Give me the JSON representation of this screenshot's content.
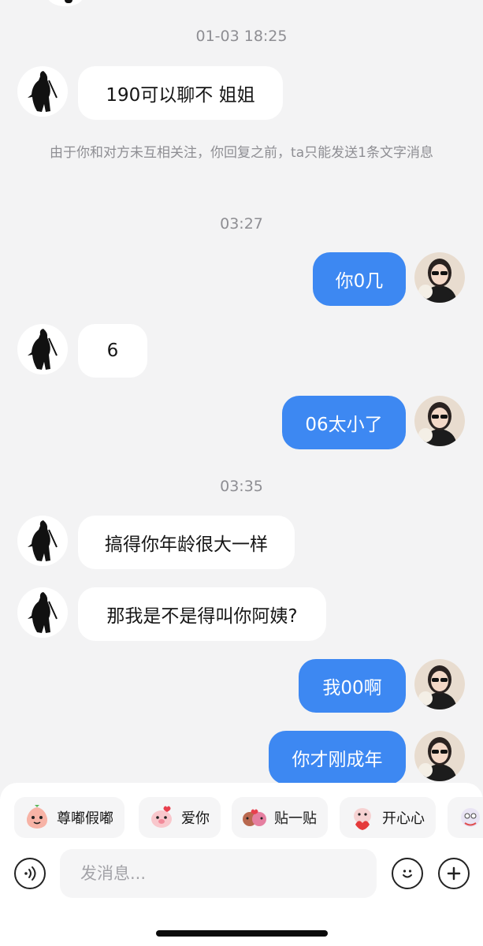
{
  "chat": {
    "timestamps": [
      "01-03 18:25",
      "03:27",
      "03:35"
    ],
    "notice": "由于你和对方未互相关注，你回复之前，ta只能发送1条文字消息",
    "messages": [
      {
        "side": "in",
        "text": "190可以聊不  姐姐"
      },
      {
        "side": "out",
        "text": "你0几"
      },
      {
        "side": "in",
        "text": "6"
      },
      {
        "side": "out",
        "text": "06太小了"
      },
      {
        "side": "in",
        "text": "搞得你年龄很大一样"
      },
      {
        "side": "in",
        "text": "那我是不是得叫你阿姨?"
      },
      {
        "side": "out",
        "text": "我00啊"
      },
      {
        "side": "out",
        "text": "你才刚成年"
      }
    ]
  },
  "quick_stickers": [
    {
      "label": "尊嘟假嘟",
      "icon": "peach-face-sticker"
    },
    {
      "label": "爱你",
      "icon": "pig-love-sticker"
    },
    {
      "label": "贴一贴",
      "icon": "cheek-to-cheek-sticker"
    },
    {
      "label": "开心心",
      "icon": "happy-heart-sticker"
    },
    {
      "label": "",
      "icon": "partial-sticker"
    }
  ],
  "input": {
    "placeholder": "发消息..."
  },
  "icons": {
    "voice": "voice-icon",
    "emoji": "emoji-icon",
    "more": "plus-icon"
  },
  "colors": {
    "outgoing_bubble": "#3d88f2",
    "background": "#f3f3f4",
    "incoming_bubble": "#ffffff"
  }
}
